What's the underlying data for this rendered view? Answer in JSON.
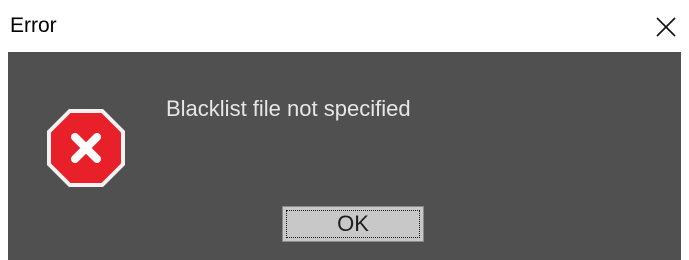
{
  "window": {
    "title": "Error"
  },
  "titlebar": {
    "close_icon": "close-icon"
  },
  "dialog": {
    "icon": "error-icon",
    "message": "Blacklist file not specified",
    "ok_label": "OK"
  },
  "colors": {
    "dialog_background": "#505050",
    "message_text": "#e6e6e6",
    "button_face": "#c8c8c8",
    "error_red": "#e8202a"
  }
}
